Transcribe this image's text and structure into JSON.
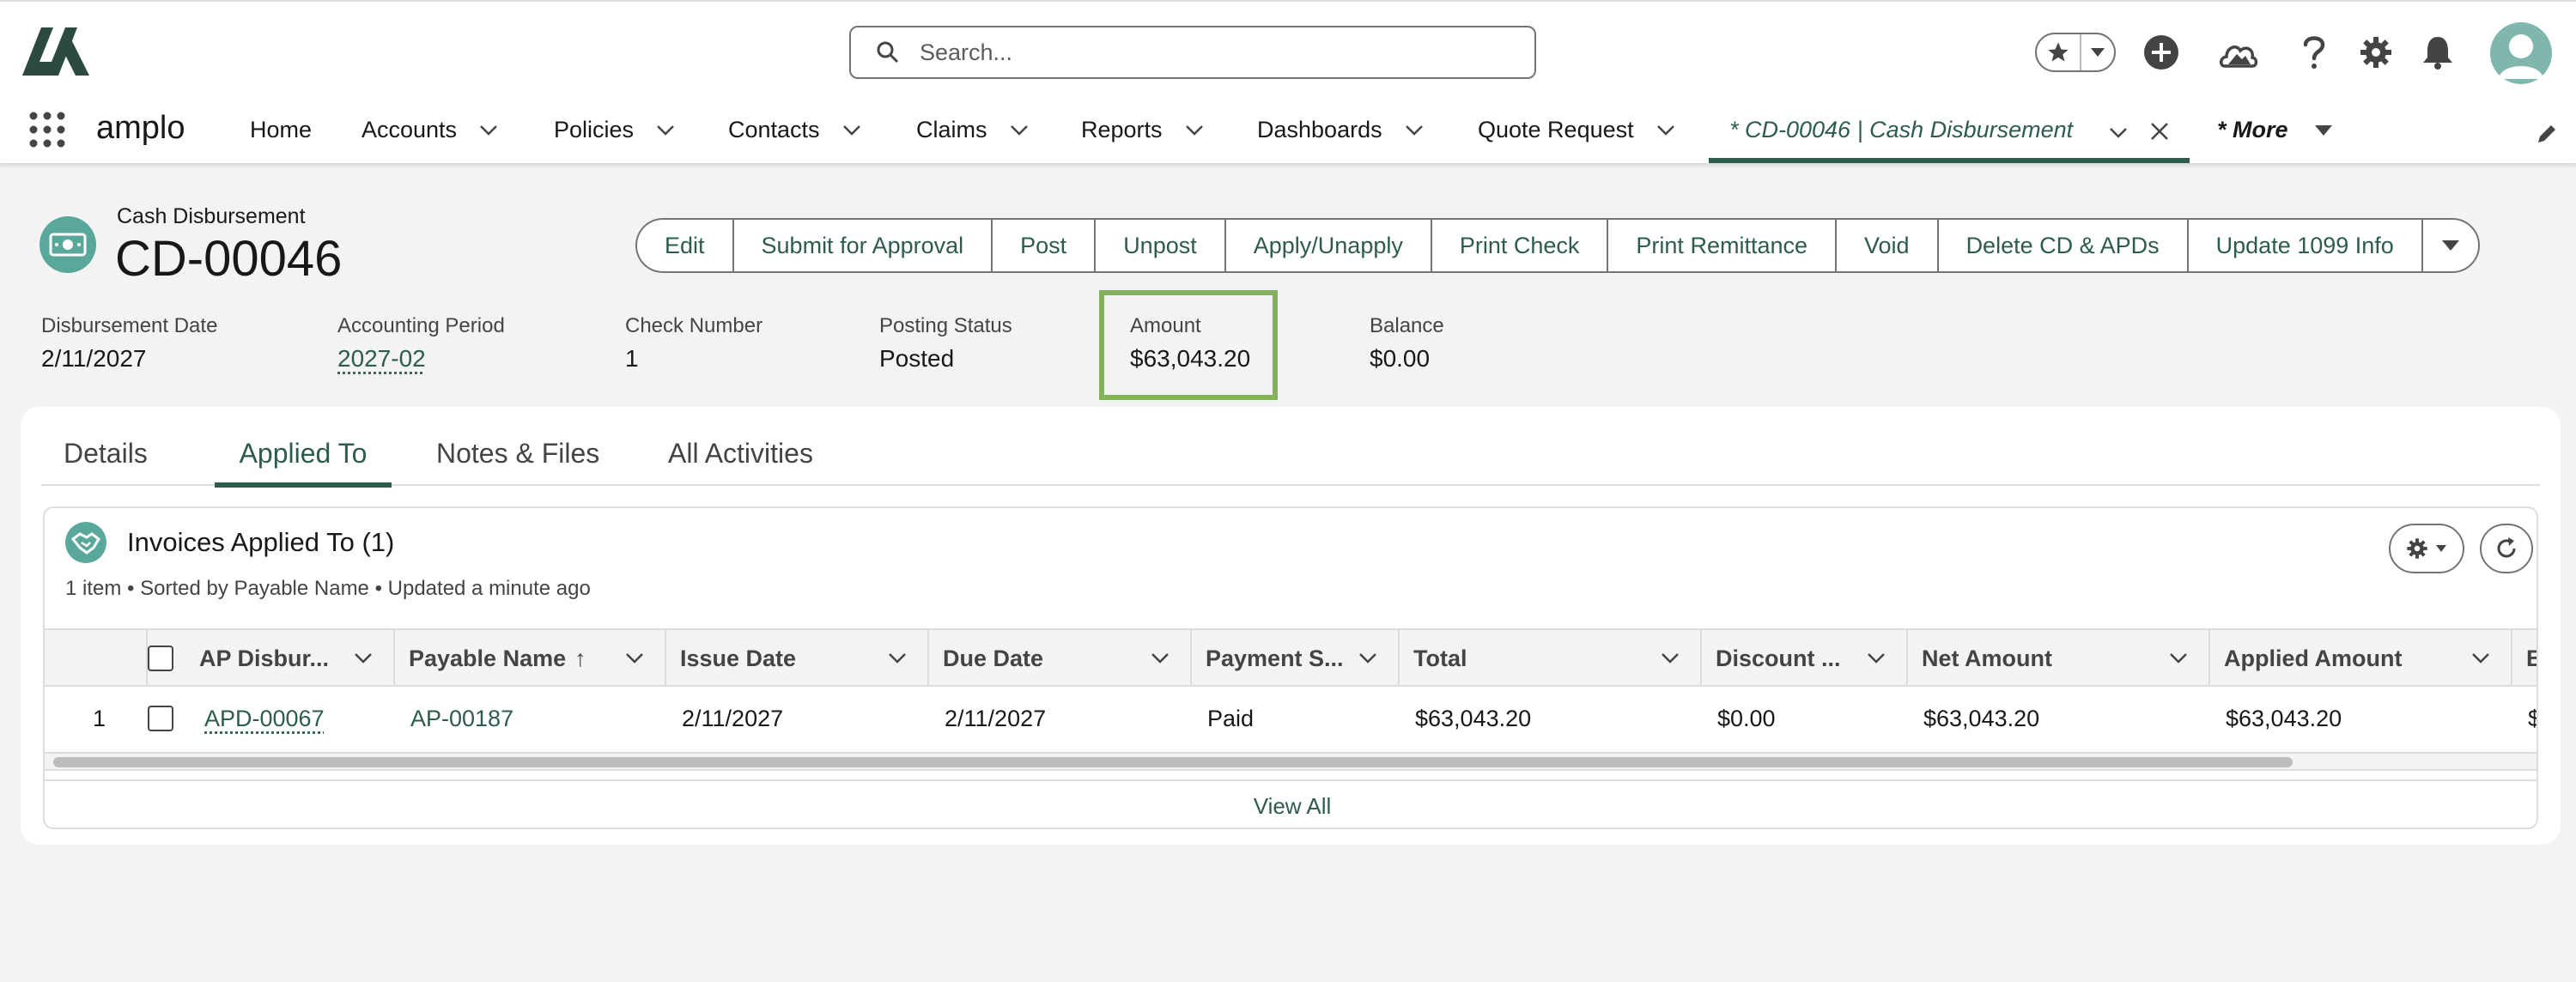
{
  "header": {
    "search_placeholder": "Search..."
  },
  "nav": {
    "app_name": "amplo",
    "items": [
      {
        "label": "Home"
      },
      {
        "label": "Accounts"
      },
      {
        "label": "Policies"
      },
      {
        "label": "Contacts"
      },
      {
        "label": "Claims"
      },
      {
        "label": "Reports"
      },
      {
        "label": "Dashboards"
      },
      {
        "label": "Quote Request"
      }
    ],
    "active_tab": "* CD-00046 | Cash Disbursement",
    "more": "* More"
  },
  "record": {
    "type": "Cash Disbursement",
    "title": "CD-00046",
    "actions": [
      "Edit",
      "Submit for Approval",
      "Post",
      "Unpost",
      "Apply/Unapply",
      "Print Check",
      "Print Remittance",
      "Void",
      "Delete CD & APDs",
      "Update 1099 Info"
    ],
    "fields": [
      {
        "label": "Disbursement Date",
        "value": "2/11/2027"
      },
      {
        "label": "Accounting Period",
        "value": "2027-02"
      },
      {
        "label": "Check Number",
        "value": "1"
      },
      {
        "label": "Posting Status",
        "value": "Posted"
      },
      {
        "label": "Amount",
        "value": "$63,043.20"
      },
      {
        "label": "Balance",
        "value": "$0.00"
      }
    ]
  },
  "tabs": [
    "Details",
    "Applied To",
    "Notes & Files",
    "All Activities"
  ],
  "related_list": {
    "title": "Invoices Applied To (1)",
    "subtitle": "1 item • Sorted by Payable Name • Updated a minute ago",
    "columns": [
      "AP Disbur...",
      "Payable Name",
      "Issue Date",
      "Due Date",
      "Payment S...",
      "Total",
      "Discount ...",
      "Net Amount",
      "Applied Amount",
      "B"
    ],
    "sort_arrow": "↑",
    "rows": [
      {
        "num": "1",
        "ap_disbursement": "APD-00067",
        "payable_name": "AP-00187",
        "issue_date": "2/11/2027",
        "due_date": "2/11/2027",
        "payment_status": "Paid",
        "total": "$63,043.20",
        "discount": "$0.00",
        "net_amount": "$63,043.20",
        "applied_amount": "$63,043.20",
        "b": "$"
      }
    ],
    "view_all": "View All"
  },
  "colors": {
    "brand": "#2d5c4c",
    "highlight": "#82b35b",
    "icon_teal": "#5aa89b"
  }
}
